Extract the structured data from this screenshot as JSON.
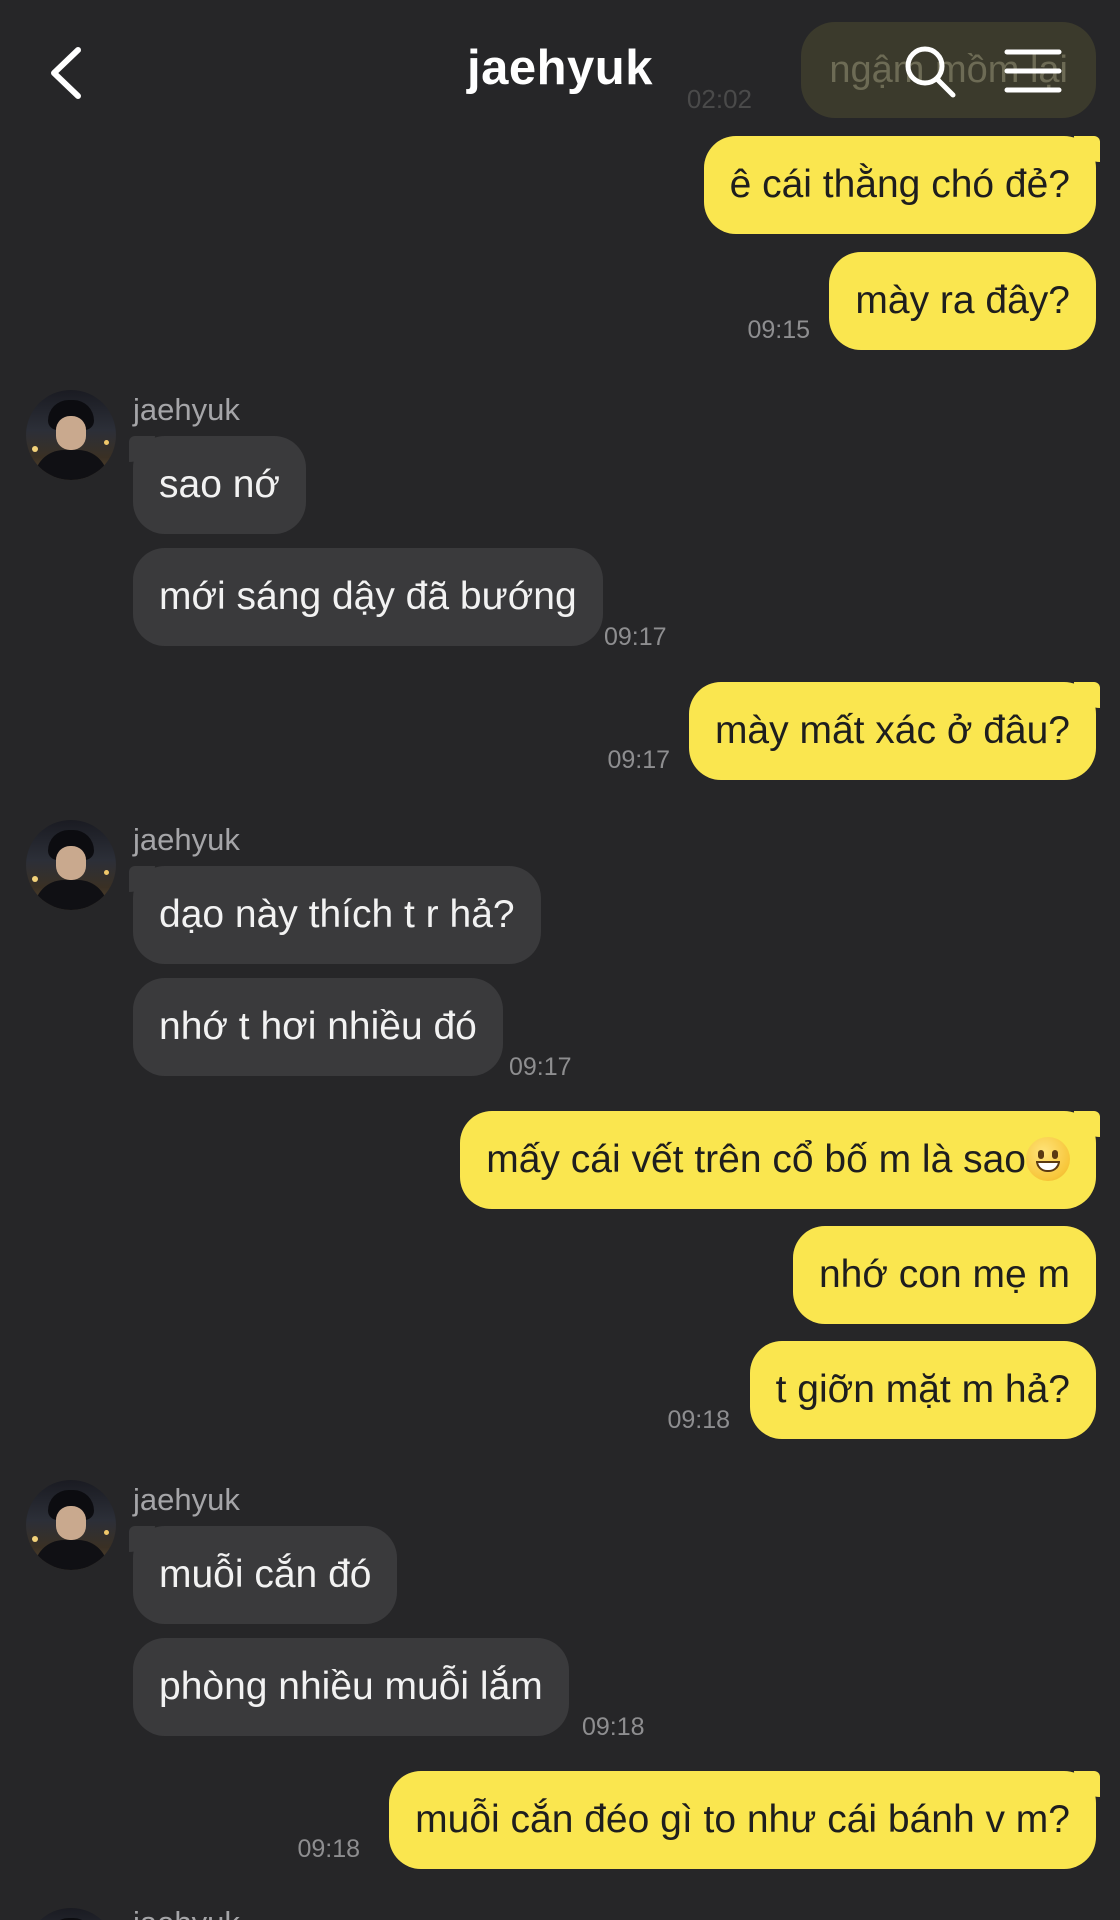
{
  "header": {
    "title": "jaehyuk",
    "back_icon": "chevron-left-icon",
    "search_icon": "search-icon",
    "menu_icon": "hamburger-menu-icon"
  },
  "faded_message": {
    "text": "ngậm mồm lại",
    "time": "02:02"
  },
  "messages": [
    {
      "side": "me",
      "text": "ê cái thằng chó đẻ?"
    },
    {
      "side": "me",
      "text": "mày ra đây?",
      "time": "09:15"
    },
    {
      "side": "them",
      "sender": "jaehyuk",
      "text": "sao nớ"
    },
    {
      "side": "them",
      "text": "mới sáng dậy đã bướng",
      "time": "09:17"
    },
    {
      "side": "me",
      "text": "mày mất xác ở đâu?",
      "time": "09:17"
    },
    {
      "side": "them",
      "sender": "jaehyuk",
      "text": "dạo này thích t r hả?"
    },
    {
      "side": "them",
      "text": "nhớ t hơi nhiều đó",
      "time": "09:17"
    },
    {
      "side": "me",
      "text": "mấy cái vết trên cổ bố m là sao",
      "emoji": "grinning-face-emoji"
    },
    {
      "side": "me",
      "text": "nhớ con mẹ m"
    },
    {
      "side": "me",
      "text": "t giỡn mặt m hả?",
      "time": "09:18"
    },
    {
      "side": "them",
      "sender": "jaehyuk",
      "text": "muỗi cắn đó"
    },
    {
      "side": "them",
      "text": "phòng nhiều muỗi lắm",
      "time": "09:18"
    },
    {
      "side": "me",
      "text": "muỗi cắn đéo gì to như cái bánh v m?",
      "time": "09:18"
    }
  ],
  "next_sender": "jaehyuk",
  "colors": {
    "background": "#262628",
    "my_bubble": "#fae64f",
    "their_bubble": "#3a3a3c"
  }
}
